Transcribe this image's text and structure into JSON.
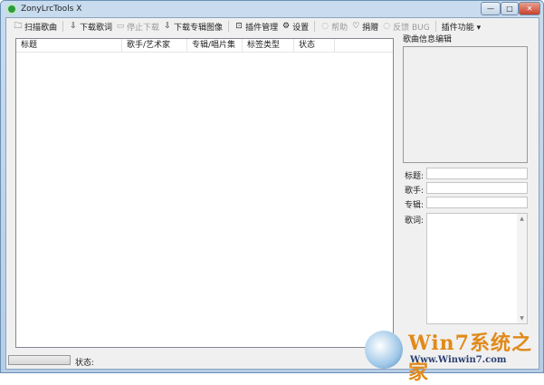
{
  "window": {
    "title": "ZonyLrcTools X",
    "min": "—",
    "max": "□",
    "close": "✕"
  },
  "toolbar": [
    {
      "label": "扫描歌曲",
      "icon": "folder-icon",
      "glyph": "🗀",
      "disabled": false
    },
    {
      "label": "下载歌词",
      "icon": "download-icon",
      "glyph": "⇩",
      "disabled": false
    },
    {
      "label": "停止下载",
      "icon": "stop-icon",
      "glyph": "▭",
      "disabled": true
    },
    {
      "label": "下载专辑图像",
      "icon": "download-icon",
      "glyph": "⇩",
      "disabled": false
    },
    {
      "label": "插件管理",
      "icon": "briefcase-icon",
      "glyph": "⊡",
      "disabled": false
    },
    {
      "label": "设置",
      "icon": "gear-icon",
      "glyph": "⚙",
      "disabled": false
    },
    {
      "label": "帮助",
      "icon": "chat-icon",
      "glyph": "◌",
      "disabled": true
    },
    {
      "label": "捐赠",
      "icon": "heart-icon",
      "glyph": "♡",
      "disabled": false
    },
    {
      "label": "反馈 BUG",
      "icon": "chat-icon",
      "glyph": "◌",
      "disabled": true
    },
    {
      "label": "插件功能 ▾",
      "icon": "",
      "glyph": "",
      "disabled": false
    }
  ],
  "list": {
    "columns": [
      "标题",
      "歌手/艺术家",
      "专辑/唱片集",
      "标签类型",
      "状态"
    ]
  },
  "panel": {
    "title": "歌曲信息编辑",
    "title_label": "标题:",
    "artist_label": "歌手:",
    "album_label": "专辑:",
    "lyrics_label": "歌词:"
  },
  "status": {
    "label": "状态:"
  },
  "watermark": {
    "line1": "Win7系统之家",
    "line2": "Www.Winwin7.com"
  }
}
